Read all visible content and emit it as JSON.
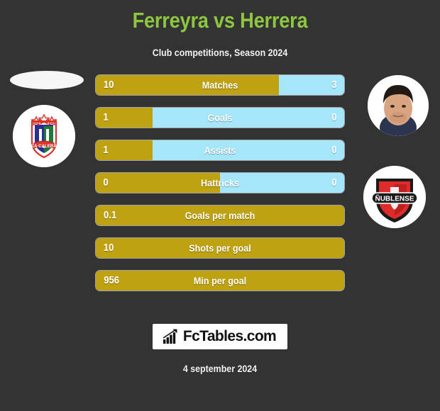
{
  "header": {
    "title": "Ferreyra vs Herrera",
    "subtitle": "Club competitions, Season 2024",
    "title_color": "#8DC63F"
  },
  "theme": {
    "background": "#333333",
    "left_color": "#BFA211",
    "right_color": "#A5E6FB",
    "text_color": "#FFFFFF"
  },
  "left_player": {
    "photo": "player-photo-placeholder",
    "club_badge": "union-la-calera-badge",
    "club_badge_text": "LA CALERA",
    "club_badge_letter": "U"
  },
  "right_player": {
    "photo": "player-photo",
    "club_badge": "nublense-badge",
    "club_badge_text": "ÑUBLENSE"
  },
  "stats": [
    {
      "label": "Matches",
      "left": "10",
      "right": "3",
      "left_pct": 73.7,
      "two_sided": true
    },
    {
      "label": "Goals",
      "left": "1",
      "right": "0",
      "left_pct": 22.9,
      "two_sided": true
    },
    {
      "label": "Assists",
      "left": "1",
      "right": "0",
      "left_pct": 22.9,
      "two_sided": true
    },
    {
      "label": "Hattricks",
      "left": "0",
      "right": "0",
      "left_pct": 50.0,
      "two_sided": true
    },
    {
      "label": "Goals per match",
      "left": "0.1",
      "right": "",
      "left_pct": 100,
      "two_sided": false
    },
    {
      "label": "Shots per goal",
      "left": "10",
      "right": "",
      "left_pct": 100,
      "two_sided": false
    },
    {
      "label": "Min per goal",
      "left": "956",
      "right": "",
      "left_pct": 100,
      "two_sided": false
    }
  ],
  "footer": {
    "logo_text": "FcTables.com",
    "logo_icon": "bar-chart-icon",
    "date": "4 september 2024"
  }
}
